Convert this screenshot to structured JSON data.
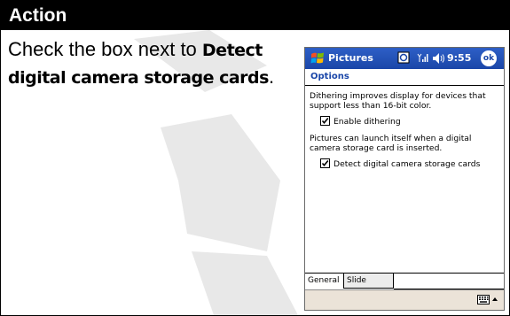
{
  "header": {
    "title": "Action"
  },
  "instruction": {
    "prefix": "Check the box next to ",
    "target": "Detect digital camera storage cards",
    "suffix": "."
  },
  "device": {
    "app_title": "Pictures",
    "time": "9:55",
    "ok_label": "ok",
    "page_heading": "Options",
    "dithering_description": "Dithering improves display for devices that support less than 16-bit color.",
    "enable_dithering": {
      "label": "Enable dithering",
      "checked": true
    },
    "launch_description": "Pictures can launch itself when a digital camera storage card is inserted.",
    "detect_cards": {
      "label": "Detect digital camera storage cards",
      "checked": true
    },
    "tabs": [
      "General",
      "Slide Show"
    ],
    "active_tab": "General"
  },
  "icons": [
    "windows-flag-icon",
    "connectivity-icon",
    "signal-icon",
    "volume-icon",
    "keyboard-icon",
    "up-arrow-icon"
  ],
  "colors": {
    "header_bg": "#000000",
    "titlebar": "#1a46a8",
    "heading": "#1a46a8",
    "menubar": "#ebe3d8",
    "watermark": "#e6e6e6"
  }
}
